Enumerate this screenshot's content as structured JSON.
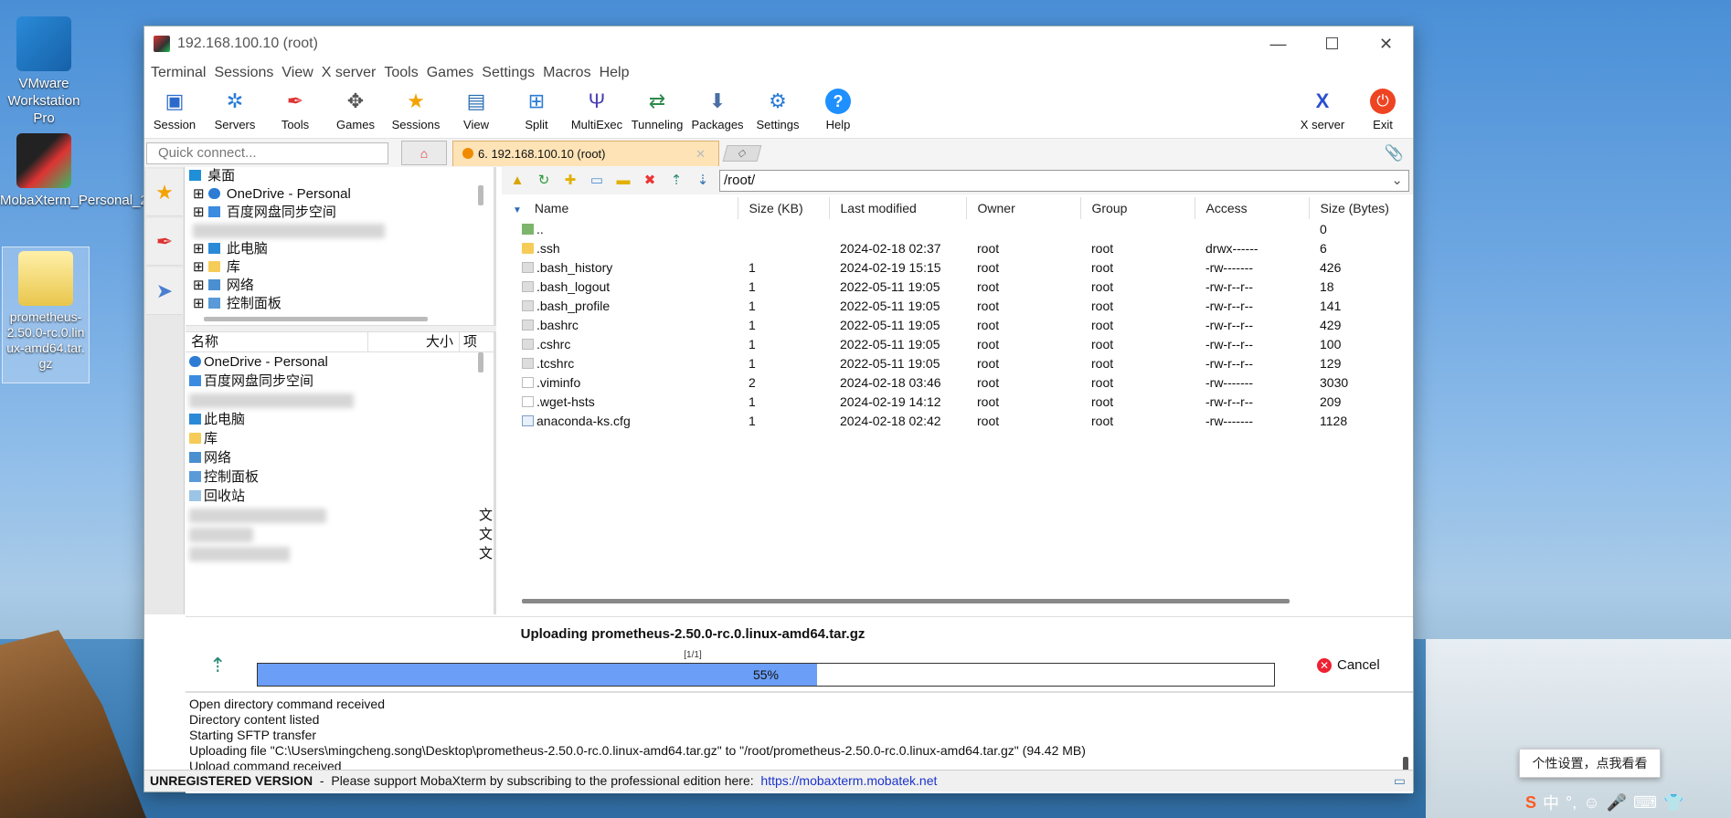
{
  "desktop": {
    "icons": [
      {
        "label": "VMware Workstation Pro"
      },
      {
        "label": "MobaXterm_Personal_2..."
      },
      {
        "label": "prometheus-2.50.0-rc.0.linux-amd64.tar.gz"
      }
    ],
    "bubble": "个性设置，点我看看",
    "tray": [
      "S",
      "中",
      "°,",
      "☺",
      "🎤",
      "⌨",
      "👕"
    ]
  },
  "window": {
    "title": "192.168.100.10 (root)",
    "controls": {
      "minimize": "—",
      "maximize": "☐",
      "close": "✕"
    },
    "menu": [
      "Terminal",
      "Sessions",
      "View",
      "X server",
      "Tools",
      "Games",
      "Settings",
      "Macros",
      "Help"
    ],
    "toolbar": [
      {
        "label": "Session",
        "icon": "session-icon"
      },
      {
        "label": "Servers",
        "icon": "servers-icon"
      },
      {
        "label": "Tools",
        "icon": "tools-icon"
      },
      {
        "label": "Games",
        "icon": "games-icon"
      },
      {
        "label": "Sessions",
        "icon": "star-icon"
      },
      {
        "label": "View",
        "icon": "view-icon"
      },
      {
        "label": "Split",
        "icon": "split-icon"
      },
      {
        "label": "MultiExec",
        "icon": "multiexec-icon"
      },
      {
        "label": "Tunneling",
        "icon": "tunneling-icon"
      },
      {
        "label": "Packages",
        "icon": "packages-icon"
      },
      {
        "label": "Settings",
        "icon": "gear-icon"
      },
      {
        "label": "Help",
        "icon": "help-icon"
      }
    ],
    "toolbar_right": [
      {
        "label": "X server",
        "icon": "x-server-icon"
      },
      {
        "label": "Exit",
        "icon": "power-icon"
      }
    ],
    "quick_connect_placeholder": "Quick connect...",
    "session_tab": "6. 192.168.100.10 (root)",
    "session_tab_close": "✕"
  },
  "local": {
    "tree": [
      {
        "label": "桌面",
        "expander": ""
      },
      {
        "label": "OneDrive - Personal",
        "expander": "⊞"
      },
      {
        "label": "百度网盘同步空间",
        "expander": "⊞"
      },
      {
        "label": "",
        "expander": ""
      },
      {
        "label": "此电脑",
        "expander": "⊞"
      },
      {
        "label": "库",
        "expander": "⊞"
      },
      {
        "label": "网络",
        "expander": "⊞"
      },
      {
        "label": "控制面板",
        "expander": "⊞"
      }
    ],
    "list_headers": {
      "name": "名称",
      "size": "大小",
      "type": "项"
    },
    "list": [
      {
        "label": "OneDrive - Personal",
        "extra": ""
      },
      {
        "label": "百度网盘同步空间",
        "extra": ""
      },
      {
        "label": "",
        "extra": ""
      },
      {
        "label": "此电脑",
        "extra": ""
      },
      {
        "label": "库",
        "extra": ""
      },
      {
        "label": "网络",
        "extra": ""
      },
      {
        "label": "控制面板",
        "extra": ""
      },
      {
        "label": "回收站",
        "extra": ""
      },
      {
        "label": "",
        "extra": "文"
      },
      {
        "label": "",
        "extra": "文"
      },
      {
        "label": "",
        "extra": "文"
      }
    ]
  },
  "remote": {
    "path": "/root/",
    "columns": [
      "Name",
      "Size (KB)",
      "Last modified",
      "Owner",
      "Group",
      "Access",
      "Size (Bytes)"
    ],
    "rows": [
      {
        "name": "..",
        "kb": "",
        "modified": "",
        "owner": "",
        "group": "",
        "access": "",
        "bytes": "0",
        "kind": "up"
      },
      {
        "name": ".ssh",
        "kb": "",
        "modified": "2024-02-18 02:37",
        "owner": "root",
        "group": "root",
        "access": "drwx------",
        "bytes": "6",
        "kind": "folder"
      },
      {
        "name": ".bash_history",
        "kb": "1",
        "modified": "2024-02-19 15:15",
        "owner": "root",
        "group": "root",
        "access": "-rw-------",
        "bytes": "426",
        "kind": "file"
      },
      {
        "name": ".bash_logout",
        "kb": "1",
        "modified": "2022-05-11 19:05",
        "owner": "root",
        "group": "root",
        "access": "-rw-r--r--",
        "bytes": "18",
        "kind": "file"
      },
      {
        "name": ".bash_profile",
        "kb": "1",
        "modified": "2022-05-11 19:05",
        "owner": "root",
        "group": "root",
        "access": "-rw-r--r--",
        "bytes": "141",
        "kind": "file"
      },
      {
        "name": ".bashrc",
        "kb": "1",
        "modified": "2022-05-11 19:05",
        "owner": "root",
        "group": "root",
        "access": "-rw-r--r--",
        "bytes": "429",
        "kind": "file"
      },
      {
        "name": ".cshrc",
        "kb": "1",
        "modified": "2022-05-11 19:05",
        "owner": "root",
        "group": "root",
        "access": "-rw-r--r--",
        "bytes": "100",
        "kind": "file"
      },
      {
        "name": ".tcshrc",
        "kb": "1",
        "modified": "2022-05-11 19:05",
        "owner": "root",
        "group": "root",
        "access": "-rw-r--r--",
        "bytes": "129",
        "kind": "file"
      },
      {
        "name": ".viminfo",
        "kb": "2",
        "modified": "2024-02-18 03:46",
        "owner": "root",
        "group": "root",
        "access": "-rw-------",
        "bytes": "3030",
        "kind": "file"
      },
      {
        "name": ".wget-hsts",
        "kb": "1",
        "modified": "2024-02-19 14:12",
        "owner": "root",
        "group": "root",
        "access": "-rw-r--r--",
        "bytes": "209",
        "kind": "file"
      },
      {
        "name": "anaconda-ks.cfg",
        "kb": "1",
        "modified": "2024-02-18 02:42",
        "owner": "root",
        "group": "root",
        "access": "-rw-------",
        "bytes": "1128",
        "kind": "file"
      }
    ]
  },
  "transfer": {
    "title": "Uploading prometheus-2.50.0-rc.0.linux-amd64.tar.gz",
    "count": "[1/1]",
    "progress": 55,
    "progress_label": "55%",
    "cancel": "Cancel"
  },
  "log": [
    "Open directory command received",
    "Directory content listed",
    "Starting SFTP transfer",
    "Uploading file \"C:\\Users\\mingcheng.song\\Desktop\\prometheus-2.50.0-rc.0.linux-amd64.tar.gz\" to \"/root/prometheus-2.50.0-rc.0.linux-amd64.tar.gz\" (94.42 MB)",
    "Upload command received"
  ],
  "status": {
    "unregistered": "UNREGISTERED VERSION",
    "message": "  -  Please support MobaXterm by subscribing to the professional edition here:  ",
    "link": "https://mobaxterm.mobatek.net"
  },
  "colors": {
    "progress": "#6a9ef7",
    "tab_active": "#fde3b6",
    "link": "#1a33cc"
  }
}
